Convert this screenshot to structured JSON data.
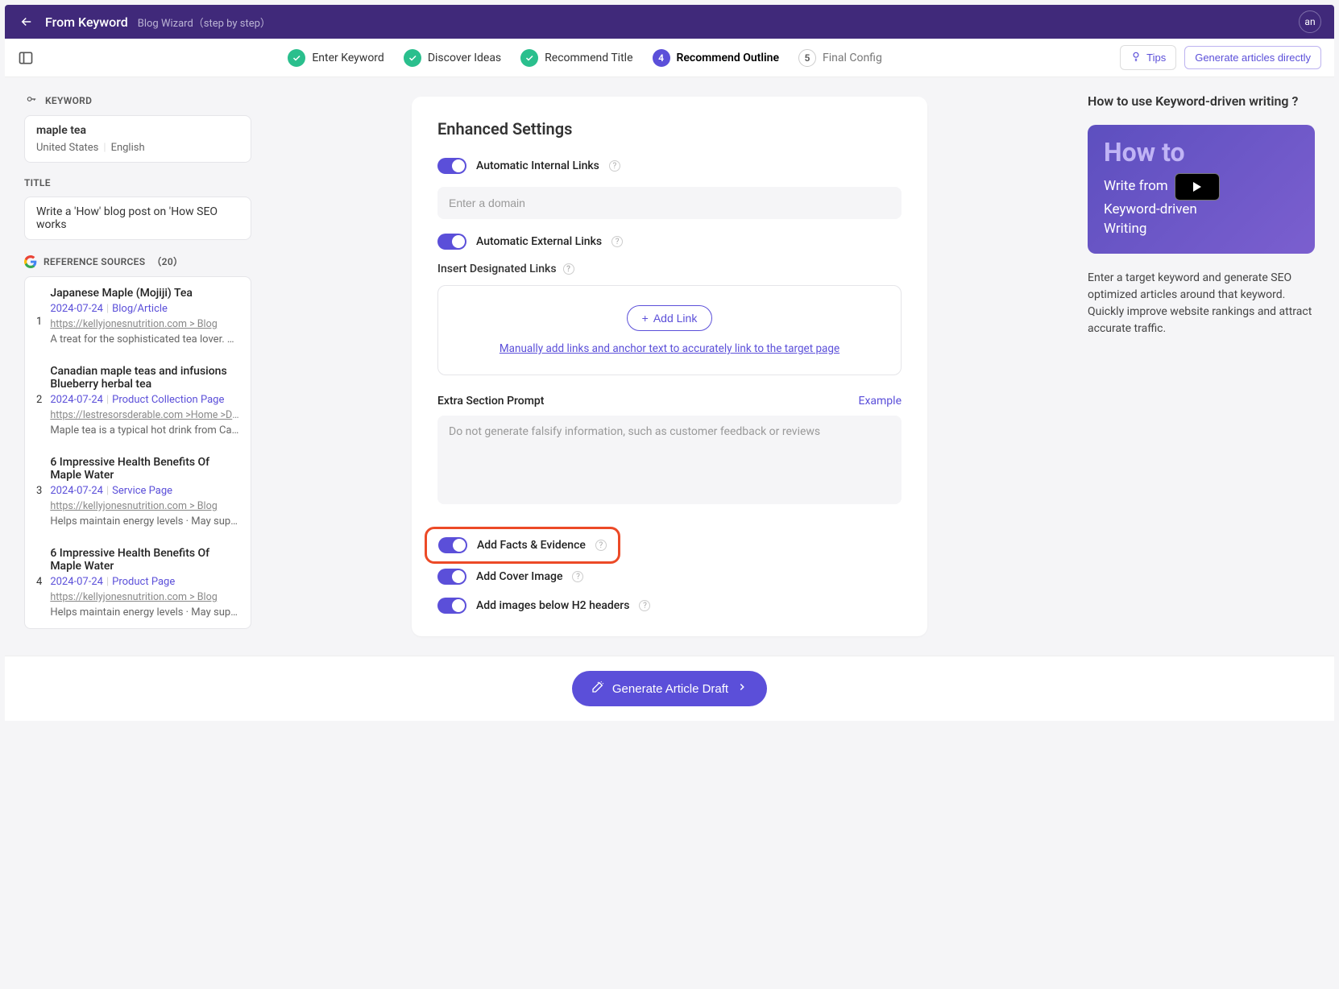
{
  "header": {
    "title": "From Keyword",
    "subtitle": "Blog Wizard（step by step）",
    "user_badge": "an"
  },
  "toolbar": {
    "tips_label": "Tips",
    "generate_label": "Generate articles directly"
  },
  "steps": [
    {
      "num": 1,
      "label": "Enter Keyword",
      "state": "done"
    },
    {
      "num": 2,
      "label": "Discover Ideas",
      "state": "done"
    },
    {
      "num": 3,
      "label": "Recommend Title",
      "state": "done"
    },
    {
      "num": 4,
      "label": "Recommend Outline",
      "state": "active"
    },
    {
      "num": 5,
      "label": "Final Config",
      "state": "idle"
    }
  ],
  "left": {
    "keyword_label": "KEYWORD",
    "keyword_value": "maple tea",
    "keyword_country": "United States",
    "keyword_lang": "English",
    "title_label": "TITLE",
    "title_value": "Write a 'How' blog post on 'How SEO works",
    "ref_label": "REFERENCE SOURCES",
    "ref_count": "（20）",
    "refs": [
      {
        "num": "1",
        "title": "Japanese Maple (Mojiji) Tea",
        "date": "2024-07-24",
        "type": "Blog/Article",
        "url": "https://kellyjonesnutrition.com > Blog",
        "desc": "A treat for the sophisticated tea lover. Ma…"
      },
      {
        "num": "2",
        "title": "Canadian maple teas and infusions Blueberry herbal tea",
        "date": "2024-07-24",
        "type": "Product Collection Page",
        "url": "https://lestresorsderable.com >Home >Drinks",
        "desc": "Maple tea is a typical hot drink from Cana…"
      },
      {
        "num": "3",
        "title": "6 Impressive Health Benefits Of Maple Water",
        "date": "2024-07-24",
        "type": "Service Page",
        "url": "https://kellyjonesnutrition.com > Blog",
        "desc": "Helps maintain energy levels · May suppo…"
      },
      {
        "num": "4",
        "title": "6 Impressive Health Benefits Of Maple Water",
        "date": "2024-07-24",
        "type": "Product Page",
        "url": "https://kellyjonesnutrition.com > Blog",
        "desc": "Helps maintain energy levels · May suppo…"
      }
    ]
  },
  "main": {
    "title": "Enhanced Settings",
    "auto_internal": "Automatic Internal Links",
    "domain_placeholder": "Enter a domain",
    "auto_external": "Automatic External Links",
    "insert_links": "Insert Designated Links",
    "add_link": "Add Link",
    "link_help": "Manually add links and anchor text to accurately link to the target page",
    "extra_prompt": "Extra Section Prompt",
    "example": "Example",
    "prompt_placeholder": "Do not generate falsify information, such as customer feedback or reviews",
    "add_facts": "Add Facts & Evidence",
    "add_cover": "Add Cover Image",
    "add_h2_images": "Add images below H2 headers"
  },
  "right": {
    "title": "How to use Keyword-driven writing ?",
    "video_big": "How to",
    "video_l1": "Write from",
    "video_l2": "Keyword-driven",
    "video_l3": "Writing",
    "desc": "Enter a target keyword and generate SEO optimized articles around that keyword. Quickly improve website rankings and attract accurate traffic."
  },
  "bottom": {
    "generate": "Generate Article Draft"
  }
}
